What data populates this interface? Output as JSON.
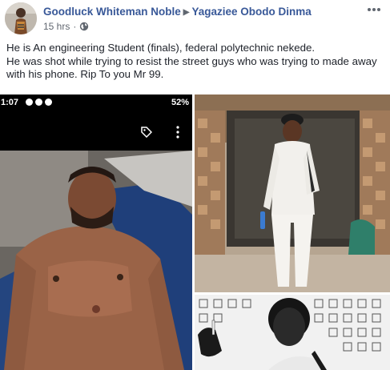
{
  "post": {
    "author": "Goodluck Whiteman Noble",
    "target": "Yagaziee Obodo Dinma",
    "timestamp": "15 hrs",
    "audience_icon": "globe-icon",
    "more_icon": "more-horizontal-icon",
    "text_line1": "He is An engineering Student (finals), federal polytechnic nekede.",
    "text_line2": "He was shot while trying to resist the street guys who was trying to made away with his phone. Rip To you Mr 99."
  },
  "photo_main": {
    "status_time": "1:07",
    "status_battery": "52%",
    "tag_icon": "tag-icon",
    "more_icon": "vertical-more-icon"
  },
  "colors": {
    "link": "#385898",
    "meta": "#616770",
    "text": "#1d2129"
  }
}
